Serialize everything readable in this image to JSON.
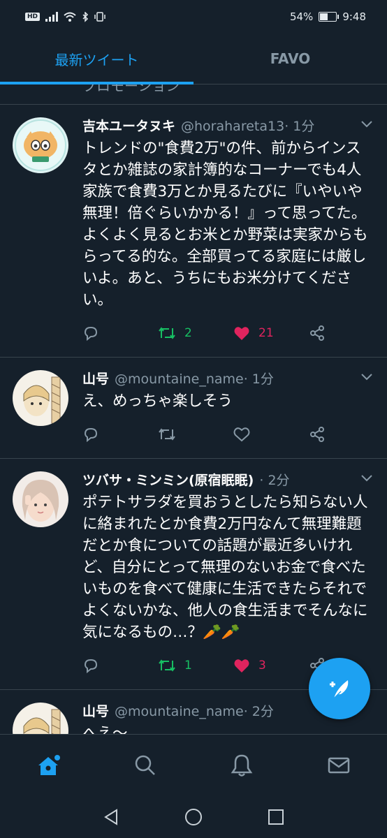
{
  "statusbar": {
    "hd": "HD",
    "battery_pct": "54%",
    "battery_level": 0.54,
    "time": "9:48"
  },
  "tabs": [
    {
      "label": "最新ツイート",
      "active": true
    },
    {
      "label": "FAVO",
      "active": false
    }
  ],
  "cut_header_text": "プロモーション",
  "tweets": [
    {
      "name": "吉本ユータヌキ",
      "handle": "@horahareta13",
      "time": " · 1分",
      "text": "トレンドの\"食費2万\"の件、前からインスタとか雑誌の家計簿的なコーナーでも4人家族で食費3万とか見るたびに『いやいや無理！倍ぐらいかかる！』って思ってた。よくよく見るとお米とか野菜は実家からもらってる的な。全部買ってる家庭には厳しいよ。あと、うちにもお米分けてください。",
      "retweets": "2",
      "likes": "21"
    },
    {
      "name": "山号",
      "handle": "@mountaine_name",
      "time": " · 1分",
      "text": "え、めっちゃ楽しそう",
      "retweets": "",
      "likes": ""
    },
    {
      "name": "ツバサ・ミンミン(原宿眠眠)",
      "handle": "",
      "time": " · 2分",
      "text": "ポテトサラダを買おうとしたら知らない人に絡まれたとか食費2万円なんて無理難題だとか食についての話題が最近多いけれど、自分にとって無理のないお金で食べたいものを食べて健康に生活できたらそれでよくないかな、他人の食生活までそんなに気になるもの…？🥕🥕",
      "retweets": "1",
      "likes": "3"
    },
    {
      "name": "山号",
      "handle": "@mountaine_name",
      "time": " · 2分",
      "text": "へえ〜",
      "retweets": "",
      "likes": ""
    }
  ],
  "colors": {
    "background": "#15202b",
    "accent": "#1da1f2",
    "retweet": "#17bf63",
    "like": "#e0245e",
    "muted": "#8899a6"
  },
  "icons": {
    "reply": "reply-icon",
    "retweet": "retweet-icon",
    "like": "heart-icon",
    "share": "share-icon",
    "compose": "compose-tweet-icon",
    "home": "home-icon",
    "search": "search-icon",
    "notifications": "bell-icon",
    "messages": "mail-icon"
  }
}
